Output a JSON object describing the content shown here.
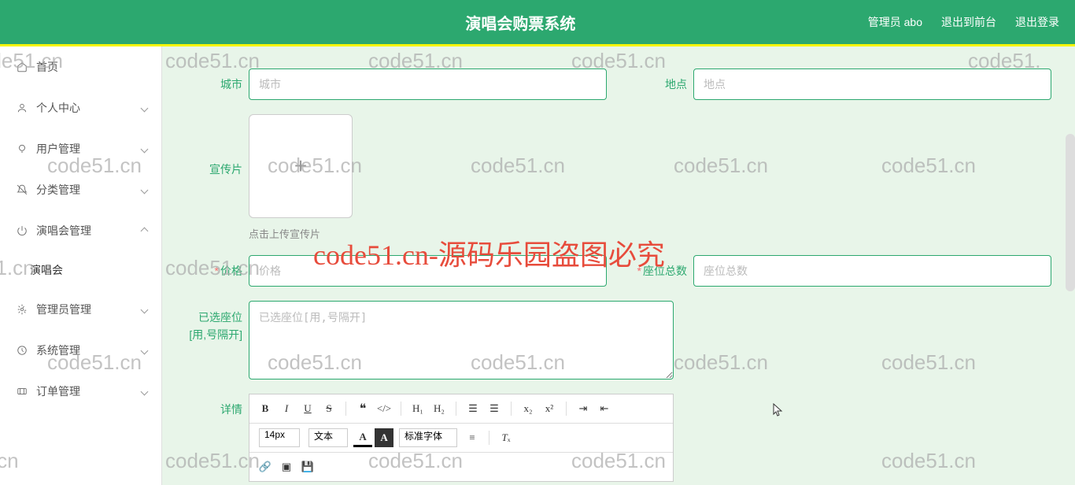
{
  "header": {
    "title": "演唱会购票系统",
    "admin_label": "管理员 abo",
    "exit_front": "退出到前台",
    "logout": "退出登录"
  },
  "sidebar": {
    "home": "首页",
    "personal": "个人中心",
    "user_mgmt": "用户管理",
    "category_mgmt": "分类管理",
    "concert_mgmt": "演唱会管理",
    "concert_sub": "演唱会",
    "admin_mgmt": "管理员管理",
    "system_mgmt": "系统管理",
    "order_mgmt": "订单管理"
  },
  "form": {
    "city_label": "城市",
    "city_placeholder": "城市",
    "location_label": "地点",
    "location_placeholder": "地点",
    "promo_label": "宣传片",
    "promo_hint": "点击上传宣传片",
    "price_label": "价格",
    "price_placeholder": "价格",
    "seats_label": "座位总数",
    "seats_placeholder": "座位总数",
    "selected_seats_label": "已选座位[用,号隔开]",
    "selected_seats_placeholder": "已选座位[用,号隔开]",
    "detail_label": "详情"
  },
  "editor": {
    "font_size": "14px",
    "text_type": "文本",
    "font_family": "标准字体"
  },
  "watermarks": {
    "text": "code51.cn",
    "red_text": "code51.cn-源码乐园盗图必究"
  }
}
